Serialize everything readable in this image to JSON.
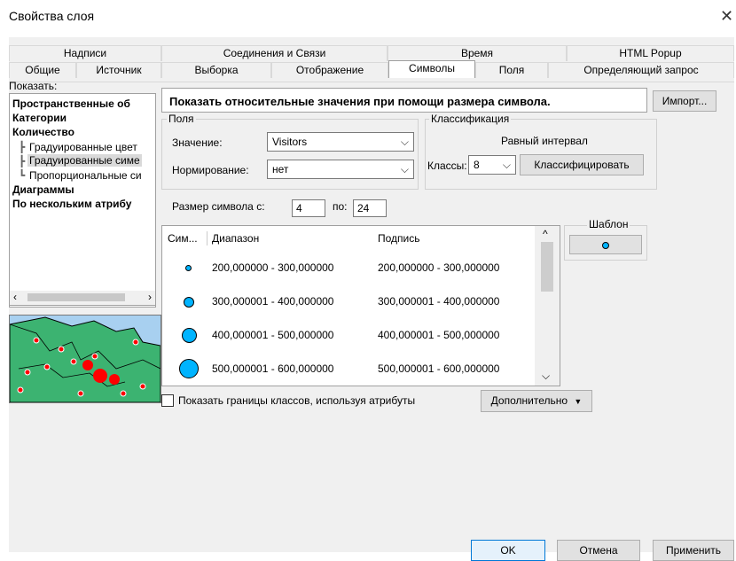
{
  "window": {
    "title": "Свойства слоя",
    "close_icon": "close-icon"
  },
  "tabs_row1": [
    "Надписи",
    "Соединения и Связи",
    "Время",
    "HTML Popup"
  ],
  "tabs_row2": [
    "Общие",
    "Источник",
    "Выборка",
    "Отображение",
    "Символы",
    "Поля",
    "Определяющий запрос"
  ],
  "active_tab": "Символы",
  "show": {
    "label": "Показать:",
    "items": [
      {
        "label": "Пространственные об",
        "bold": true
      },
      {
        "label": "Категории",
        "bold": true
      },
      {
        "label": "Количество",
        "bold": true
      },
      {
        "label": "Градуированные цвет",
        "bold": false
      },
      {
        "label": "Градуированные симе",
        "bold": false
      },
      {
        "label": "Пропорциональные си",
        "bold": false
      },
      {
        "label": "Диаграммы",
        "bold": true
      },
      {
        "label": "По нескольким атрибу",
        "bold": true
      }
    ]
  },
  "description": "Показать относительные значения при помощи размера символа.",
  "import_label": "Импорт...",
  "fields": {
    "title": "Поля",
    "value_label": "Значение:",
    "value": "Visitors",
    "norm_label": "Нормирование:",
    "norm_value": "нет"
  },
  "classification": {
    "title": "Классификация",
    "method": "Равный интервал",
    "classes_label": "Классы:",
    "classes_value": "8",
    "classify_label": "Классифицировать"
  },
  "symbol_size": {
    "label": "Размер символа с:",
    "from": "4",
    "to_label": "по:",
    "to": "24"
  },
  "template": {
    "label": "Шаблон"
  },
  "table": {
    "headers": [
      "Сим...",
      "Диапазон",
      "Подпись"
    ],
    "rows": [
      {
        "range": "200,000000 - 300,000000",
        "label": "200,000000 - 300,000000",
        "size": 7
      },
      {
        "range": "300,000001 - 400,000000",
        "label": "300,000001 - 400,000000",
        "size": 12
      },
      {
        "range": "400,000001 - 500,000000",
        "label": "400,000001 - 500,000000",
        "size": 17
      },
      {
        "range": "500,000001 - 600,000000",
        "label": "500,000001 - 600,000000",
        "size": 22
      }
    ]
  },
  "show_class_bounds": "Показать границы классов, используя атрибуты",
  "advanced_label": "Дополнительно",
  "footer": {
    "ok": "OK",
    "cancel": "Отмена",
    "apply": "Применить"
  },
  "colors": {
    "symbol_fill": "#00b4ff",
    "preview_water": "#a8d0f0",
    "preview_land": "#3cb371",
    "preview_dot": "#ff0000"
  }
}
